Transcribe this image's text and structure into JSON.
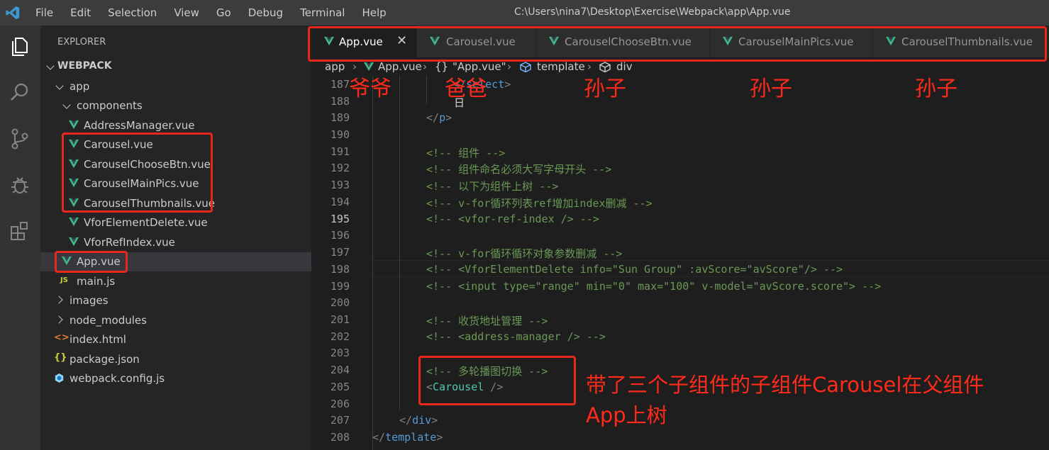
{
  "titlebar": {
    "menu": [
      "File",
      "Edit",
      "Selection",
      "View",
      "Go",
      "Debug",
      "Terminal",
      "Help"
    ],
    "window_title": "C:\\Users\\nina7\\Desktop\\Exercise\\Webpack\\app\\App.vue"
  },
  "sidebar": {
    "title": "EXPLORER",
    "root": "WEBPACK",
    "items": [
      {
        "label": "app"
      },
      {
        "label": "components"
      },
      {
        "label": "AddressManager.vue"
      },
      {
        "label": "Carousel.vue"
      },
      {
        "label": "CarouselChooseBtn.vue"
      },
      {
        "label": "CarouselMainPics.vue"
      },
      {
        "label": "CarouselThumbnails.vue"
      },
      {
        "label": "VforElementDelete.vue"
      },
      {
        "label": "VforRefIndex.vue"
      },
      {
        "label": "App.vue"
      },
      {
        "label": "main.js"
      },
      {
        "label": "images"
      },
      {
        "label": "node_modules"
      },
      {
        "label": "index.html"
      },
      {
        "label": "package.json"
      },
      {
        "label": "webpack.config.js"
      }
    ]
  },
  "tabs": [
    {
      "label": "App.vue"
    },
    {
      "label": "Carousel.vue"
    },
    {
      "label": "CarouselChooseBtn.vue"
    },
    {
      "label": "CarouselMainPics.vue"
    },
    {
      "label": "CarouselThumbnails.vue"
    }
  ],
  "breadcrumb": {
    "app": "app",
    "file": "App.vue",
    "obj": "\"App.vue\"",
    "template": "template",
    "div": "div"
  },
  "code": {
    "line_numbers": [
      "187",
      "188",
      "189",
      "190",
      "191",
      "192",
      "193",
      "194",
      "195",
      "196",
      "197",
      "198",
      "199",
      "200",
      "201",
      "202",
      "203",
      "204",
      "205",
      "206",
      "207",
      "208"
    ],
    "l187_pre": "</",
    "l187_name": "select",
    "l187_post": ">",
    "l188": "日",
    "l189_pre": "</",
    "l189_name": "p",
    "l189_post": ">",
    "l191": "<!-- 组件 -->",
    "l192": "<!-- 组件命名必须大写字母开头 -->",
    "l193": "<!-- 以下为组件上树 -->",
    "l194": "<!-- v-for循环列表ref增加index删减 -->",
    "l195": "<!-- <vfor-ref-index /> -->",
    "l197": "<!-- v-for循环循环对象参数删减 -->",
    "l198": "<!-- <VforElementDelete info=\"Sun Group\" :avScore=\"avScore\"/> -->",
    "l199": "<!-- <input type=\"range\" min=\"0\" max=\"100\" v-model=\"avScore.score\"> -->",
    "l201": "<!-- 收货地址管理 -->",
    "l202": "<!-- <address-manager /> -->",
    "l204": "<!-- 多轮播图切换 -->",
    "l205_pre": "<",
    "l205_name": "Carousel",
    "l205_post": " />",
    "l207_pre": "</",
    "l207_name": "div",
    "l207_post": ">",
    "l208_pre": "</",
    "l208_name": "template",
    "l208_post": ">"
  },
  "annotations": {
    "grandpa": "爷爷",
    "dad": "爸爸",
    "grandson1": "孙子",
    "grandson2": "孙子",
    "grandson3": "孙子",
    "note_line1": "带了三个子组件的子组件Carousel在父组件",
    "note_line2": "App上树"
  },
  "colors": {
    "vue_green": "#41b883",
    "annotation_red": "#ff2a1a"
  }
}
